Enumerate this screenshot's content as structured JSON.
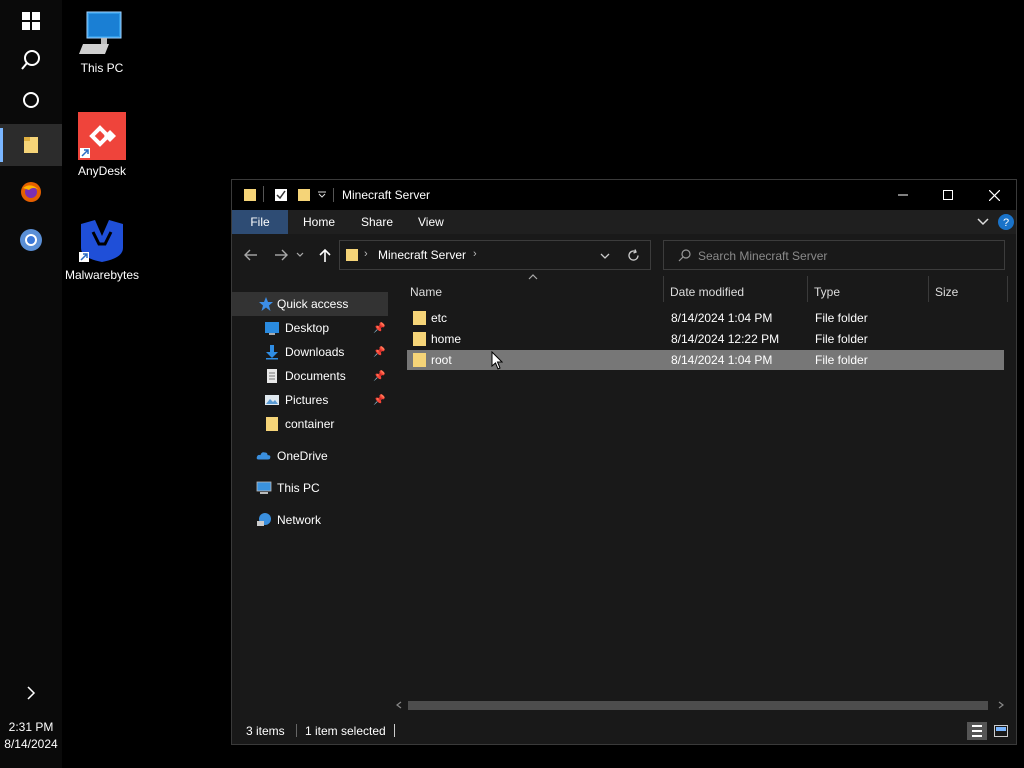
{
  "taskbar": {
    "buttons": [
      {
        "icon": "windows-start-icon"
      },
      {
        "icon": "search-icon"
      },
      {
        "icon": "cortana-icon"
      },
      {
        "icon": "file-explorer-icon",
        "active": true
      },
      {
        "icon": "firefox-icon"
      },
      {
        "icon": "chrome-icon"
      }
    ],
    "expand_icon": "chevron-right-icon",
    "clock": {
      "time": "2:31 PM",
      "date": "8/14/2024"
    }
  },
  "desktop": {
    "icons": [
      {
        "label": "This PC",
        "icon": "this-pc-icon"
      },
      {
        "label": "AnyDesk",
        "icon": "anydesk-icon"
      },
      {
        "label": "Malwarebytes",
        "icon": "malwarebytes-icon"
      }
    ]
  },
  "explorer": {
    "title": "Minecraft Server",
    "ribbon_tabs": [
      "File",
      "Home",
      "Share",
      "View"
    ],
    "address": {
      "crumb": "Minecraft Server"
    },
    "search": {
      "placeholder": "Search Minecraft Server"
    },
    "nav_pane": {
      "quick_access": "Quick access",
      "pinned": [
        "Desktop",
        "Downloads",
        "Documents",
        "Pictures"
      ],
      "recent": [
        "container"
      ],
      "onedrive": "OneDrive",
      "this_pc": "This PC",
      "network": "Network"
    },
    "columns": [
      "Name",
      "Date modified",
      "Type",
      "Size"
    ],
    "rows": [
      {
        "name": "etc",
        "date": "8/14/2024 1:04 PM",
        "type": "File folder",
        "size": ""
      },
      {
        "name": "home",
        "date": "8/14/2024 12:22 PM",
        "type": "File folder",
        "size": ""
      },
      {
        "name": "root",
        "date": "8/14/2024 1:04 PM",
        "type": "File folder",
        "size": "",
        "selected": true
      }
    ],
    "status": {
      "count": "3 items",
      "selection": "1 item selected"
    },
    "colors": {
      "accent": "#2e4c74",
      "folder": "#f5d478",
      "selected_row": "#777777"
    }
  }
}
